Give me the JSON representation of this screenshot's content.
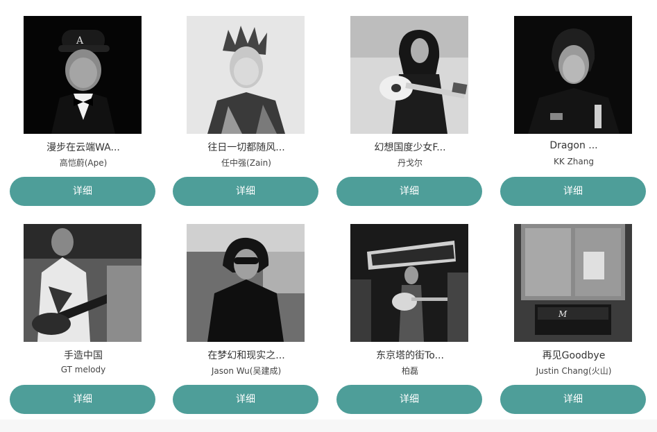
{
  "albums": [
    {
      "title": "漫步在云端WA...",
      "artist": "高恺蔚(Ape)",
      "button": "详细",
      "image": "portrait-cap-bowtie"
    },
    {
      "title": "往日一切都随风...",
      "artist": "任中强(Zain)",
      "button": "详细",
      "image": "portrait-spiky-hair"
    },
    {
      "title": "幻想国度少女F...",
      "artist": "丹戈尔",
      "button": "详细",
      "image": "girl-with-guitar"
    },
    {
      "title": "Dragon ...",
      "artist": "KK Zhang",
      "button": "详细",
      "image": "portrait-dark-jacket"
    },
    {
      "title": "手造中国",
      "artist": "GT melody",
      "button": "详细",
      "image": "electric-guitarist"
    },
    {
      "title": "在梦幻和现实之...",
      "artist": "Jason Wu(吴建成)",
      "button": "详细",
      "image": "man-sunglasses"
    },
    {
      "title": "东京塔的街To...",
      "artist": "柏磊",
      "button": "详细",
      "image": "stage-acoustic-guitar"
    },
    {
      "title": "再见Goodbye",
      "artist": "Justin Chang(火山)",
      "button": "详细",
      "image": "studio-amplifier"
    }
  ],
  "colors": {
    "button_bg": "#4e9e99",
    "button_text": "#ffffff"
  }
}
